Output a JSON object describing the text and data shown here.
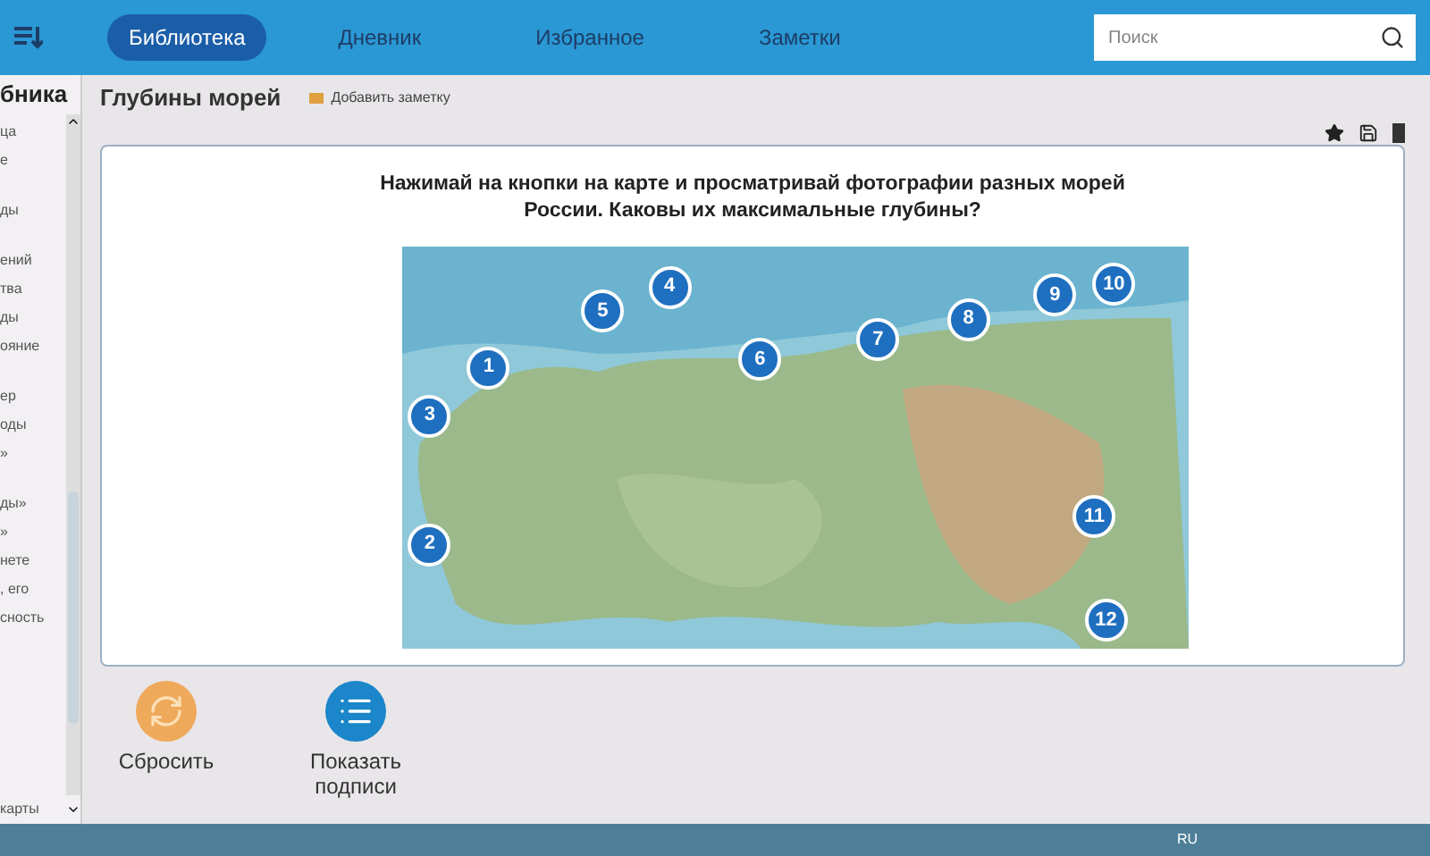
{
  "nav_tabs": [
    {
      "label": "Библиотека",
      "selected": true
    },
    {
      "label": "Дневник",
      "selected": false
    },
    {
      "label": "Избранное",
      "selected": false
    },
    {
      "label": "Заметки",
      "selected": false
    }
  ],
  "search": {
    "placeholder": "Поиск"
  },
  "sidebar": {
    "title": "бника",
    "groups": [
      [
        "ца",
        "е"
      ],
      [
        "ды"
      ],
      [
        "ений",
        "тва",
        "ды",
        "ояние"
      ],
      [
        "ер",
        "оды",
        "»"
      ],
      [
        "ды»",
        "»",
        "нете",
        ", его",
        "сность"
      ]
    ],
    "footer": "карты"
  },
  "page": {
    "title": "Глубины морей",
    "add_note": "Добавить заметку"
  },
  "task": {
    "prompt": "Нажимай на кнопки на карте и просматривай фотографии разных морей России. Каковы их максимальные глубины?",
    "markers": [
      "1",
      "2",
      "3",
      "4",
      "5",
      "6",
      "7",
      "8",
      "9",
      "10",
      "11",
      "12"
    ]
  },
  "actions": [
    {
      "kind": "reset",
      "label": "Сбросить"
    },
    {
      "kind": "labels",
      "label": "Показать подписи"
    }
  ],
  "taskbar": {
    "language": "RU"
  }
}
